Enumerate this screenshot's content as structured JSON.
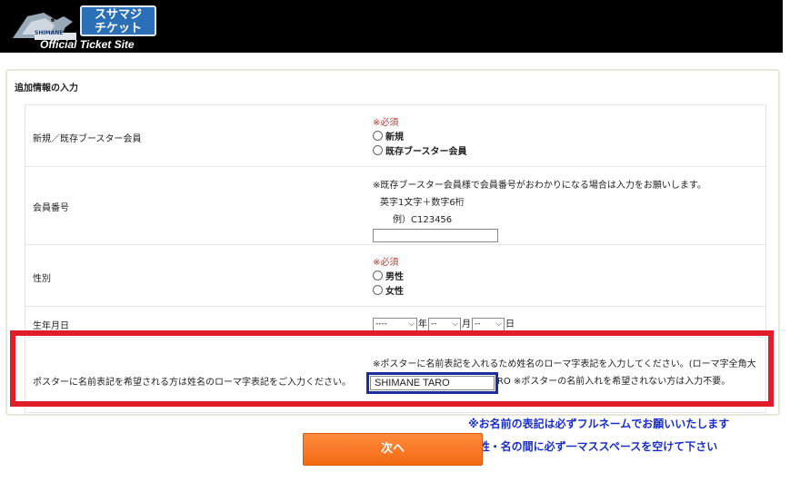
{
  "header": {
    "logo_badge_line1": "スサマジ",
    "logo_badge_line2": "チケット",
    "logo_small": "SHIMANE",
    "logo_text": "Official Ticket Site"
  },
  "panel": {
    "title": "追加情報の入力"
  },
  "form": {
    "member_type": {
      "label": "新規／既存ブースター会員",
      "required": "※必須",
      "options": [
        "新規",
        "既存ブースター会員"
      ]
    },
    "member_number": {
      "label": "会員番号",
      "note1": "※既存ブースター会員様で会員番号がおわかりになる場合は入力をお願いします。",
      "note2": "英字1文字＋数字6桁",
      "note3": "例）C123456",
      "value": ""
    },
    "gender": {
      "label": "性別",
      "required": "※必須",
      "options": [
        "男性",
        "女性"
      ]
    },
    "birthdate": {
      "label": "生年月日",
      "year_value": "----",
      "month_value": "--",
      "day_value": "--",
      "year_unit": "年",
      "month_unit": "月",
      "day_unit": "日"
    },
    "poster_name": {
      "label": "ポスターに名前表記を希望される方は姓名のローマ字表記をご入力ください。",
      "note_line1": "※ポスターに名前表記を入れるため姓名のローマ字表記を入力してください。(ローマ字全角大",
      "note_line2": "文字のみ) ※例：SHIMANE TARO ※ポスターの名前入れを希望されない方は入力不要。",
      "value": "SHIMANE  TARO"
    }
  },
  "notes": {
    "line1": "※お名前の表記は必ずフルネームでお願いいたします",
    "line2": "※姓・名の間に必ず一マススペースを空けて下さい"
  },
  "next_button": {
    "label": "次へ"
  },
  "colors": {
    "highlight": "#e11d2a",
    "note_text": "#1a2fc8",
    "button": "#f26a12",
    "required": "#c0392b"
  }
}
